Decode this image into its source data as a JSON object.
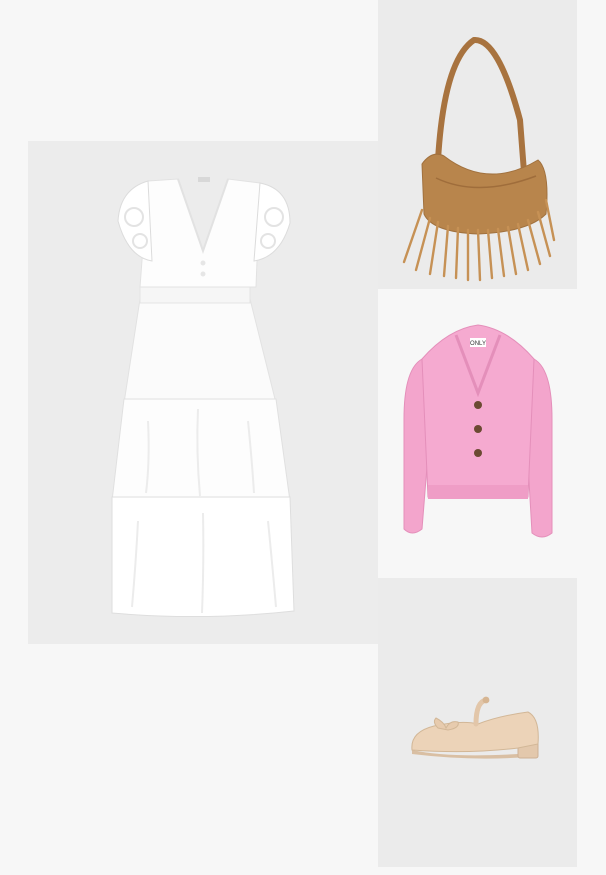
{
  "outfit": {
    "items": [
      {
        "id": "dress",
        "product": "white-tiered-midi-dress",
        "color": "#ffffff"
      },
      {
        "id": "bag",
        "product": "fringed-suede-shoulder-bag",
        "color": "#b8854c"
      },
      {
        "id": "cardigan",
        "product": "pink-knit-cropped-cardigan",
        "color": "#f5a9cf",
        "label_text": "ONLY"
      },
      {
        "id": "shoe",
        "product": "beige-mary-jane-ballet-flat",
        "color": "#ecd3b8"
      }
    ]
  },
  "colors": {
    "page_background": "#f7f7f7",
    "tile_background": "#ebebeb"
  }
}
